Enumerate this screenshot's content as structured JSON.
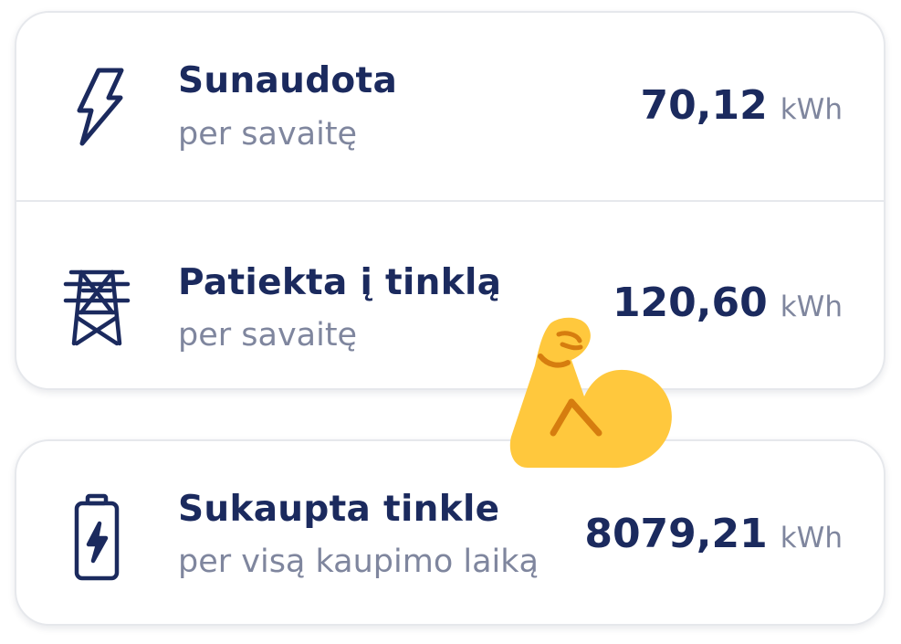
{
  "stats": {
    "consumed": {
      "title": "Sunaudota",
      "subtitle": "per savaitę",
      "value": "70,12",
      "unit": "kWh",
      "icon": "lightning-bolt-icon"
    },
    "supplied": {
      "title": "Patiekta į tinklą",
      "subtitle": "per savaitę",
      "value": "120,60",
      "unit": "kWh",
      "icon": "power-tower-icon"
    },
    "stored": {
      "title": "Sukaupta tinkle",
      "subtitle": "per visą kaupimo laiką",
      "value": "8079,21",
      "unit": "kWh",
      "icon": "battery-charging-icon"
    }
  },
  "overlay": {
    "icon": "flexed-biceps-emoji"
  },
  "colors": {
    "primary_text": "#1b2a5e",
    "secondary_text": "#7f869e",
    "card_border": "#e6e8ec",
    "emoji_yellow": "#ffc83d",
    "emoji_shade": "#d67d0f"
  }
}
